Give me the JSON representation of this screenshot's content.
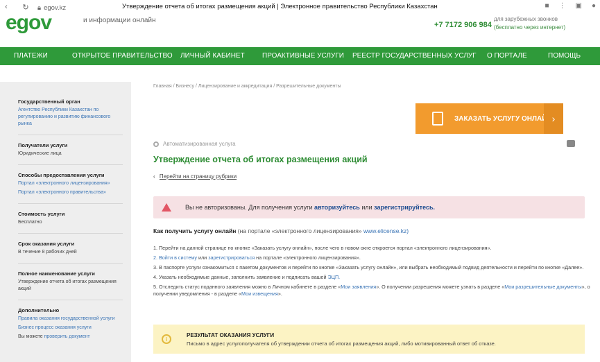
{
  "browser": {
    "url": "egov.kz",
    "tab_title": "Утверждение отчета об итогах размещения акций | Электронное правительство Республики Казахстан"
  },
  "header": {
    "subtitle": "и информации онлайн",
    "phone": "+7 7172 906 984",
    "phone_note_1": "для зарубежных звонков",
    "phone_note_2": "(бесплатно через интернет)"
  },
  "menu": [
    {
      "label": "ПЛАТЕЖИ"
    },
    {
      "label": "ОТКРЫТОЕ ПРАВИТЕЛЬСТВО"
    },
    {
      "label": "ЛИЧНЫЙ КАБИНЕТ"
    },
    {
      "label": "ПРОАКТИВНЫЕ УСЛУГИ"
    },
    {
      "label": "РЕЕСТР ГОСУДАРСТВЕННЫХ УСЛУГ"
    },
    {
      "label": "О ПОРТАЛЕ"
    },
    {
      "label": "ПОМОЩЬ"
    }
  ],
  "sidebar": {
    "gov_title": "Государственный орган",
    "gov_link": "Агентство Республики Казахстан по регулированию и развитию финансового рынка",
    "recipients_title": "Получатели услуги",
    "recipients_text": "Юридические лица",
    "methods_title": "Способы предоставления услуги",
    "method_1": "Портал «электронного лицензирования»",
    "method_2": "Портал «электронного правительства»",
    "cost_title": "Стоимость услуги",
    "cost_text": "Бесплатно",
    "term_title": "Срок оказания услуги",
    "term_text": "В течение 8 рабочих дней",
    "fullname_title": "Полное наименование услуги",
    "fullname_text": "Утверждение отчета об итогах размещения акций",
    "extra_title": "Дополнительно",
    "extra_link_1": "Правила оказания государственной услуги",
    "extra_link_2": "Бизнес процесс оказания услуги",
    "extra_text_3": "Вы можете",
    "extra_link_3": "проверить документ"
  },
  "main": {
    "breadcrumbs": "Главная / Бизнесу / Лицензирование и аккредитация / Разрешительные документы",
    "order_button": "ЗАКАЗАТЬ УСЛУГУ ОНЛАЙН",
    "auto_tag": "Автоматизированная услуга",
    "title": "Утверждение отчета об итогах размещения акций",
    "back_link": "Перейти на страницу рубрики",
    "alert_text_1": "Вы не авторизованы. Для получения услуги",
    "alert_link_1": "авторизуйтесь",
    "alert_text_2": "или",
    "alert_link_2": "зарегистрируйтесь.",
    "how_title": "Как получить услугу онлайн",
    "how_note": "(на портале «электронного лицензирования»",
    "how_link": "www.elicense.kz)",
    "step_1": "1. Перейти на данной странице по кнопке «Заказать услугу онлайн», после чего в новом окне откроется портал «электронного лицензирования».",
    "step_2_link_a": "2. Войти в систему",
    "step_2_text": "или",
    "step_2_link_b": "зарегистрироваться",
    "step_2_tail": "на портале «электронного лицензирования».",
    "step_3": "3. В паспорте услуги ознакомиться с пакетом документов и перейти по кнопке «Заказать услугу онлайн», или выбрать необходимый подвид деятельности и перейти по кнопке «Далее».",
    "step_4_text": "4. Указать необходимые данные, заполнить заявление и подписать вашей",
    "step_4_link": "ЭЦП.",
    "step_5_text_a": "5. Отследить статус поданного заявления можно в Личном кабинете в разделе «",
    "step_5_link_a": "Мои заявления",
    "step_5_text_b": "». О получении разрешения можете узнать в разделе «",
    "step_5_link_b": "Мои разрешительные документы",
    "step_5_text_c": "», о получении уведомления - в разделе «",
    "step_5_link_c": "Мои извещения",
    "step_5_text_d": "».",
    "result_title": "РЕЗУЛЬТАТ ОКАЗАНИЯ УСЛУГИ",
    "result_text": "Письмо в адрес услугополучателя об утверждении отчета об итогах размещения акций, либо мотивированный ответ об отказе."
  }
}
